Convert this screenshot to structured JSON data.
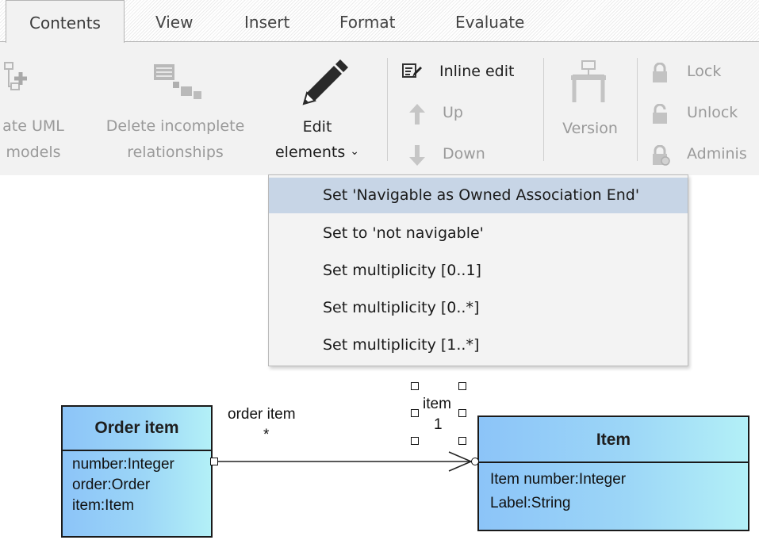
{
  "tabs": [
    {
      "label": "Contents"
    },
    {
      "label": "View"
    },
    {
      "label": "Insert"
    },
    {
      "label": "Format"
    },
    {
      "label": "Evaluate"
    }
  ],
  "ribbon": {
    "create_uml_line1": "ate UML",
    "create_uml_line2": "models",
    "delete_line1": "Delete incomplete",
    "delete_line2": "relationships",
    "edit_line1": "Edit",
    "edit_line2": "elements",
    "edit_chevron": "⌄",
    "inline_edit": "Inline edit",
    "up": "Up",
    "down": "Down",
    "version": "Version",
    "lock": "Lock",
    "unlock": "Unlock",
    "admin": "Adminis"
  },
  "menu": {
    "items": [
      {
        "label": "Set 'Navigable as Owned Association End'"
      },
      {
        "label": "Set to 'not navigable'"
      },
      {
        "label": "Set multiplicity [0..1]"
      },
      {
        "label": "Set multiplicity [0..*]"
      },
      {
        "label": "Set multiplicity [1..*]"
      }
    ]
  },
  "diagram": {
    "order_item": {
      "title": "Order item",
      "attributes": [
        "number:Integer",
        "order:Order",
        "item:Item"
      ]
    },
    "item": {
      "title": "Item",
      "attributes": [
        "Item number:Integer",
        "Label:String"
      ]
    },
    "association": {
      "source_role": "order item",
      "source_multiplicity": "*",
      "target_role": "item",
      "target_multiplicity": "1"
    }
  },
  "colors": {
    "ribbon_bg": "#f2f2f2",
    "menu_highlight": "#c7d5e6",
    "class_fill_start": "#8cc4f8",
    "class_fill_end": "#b3f0f7"
  }
}
